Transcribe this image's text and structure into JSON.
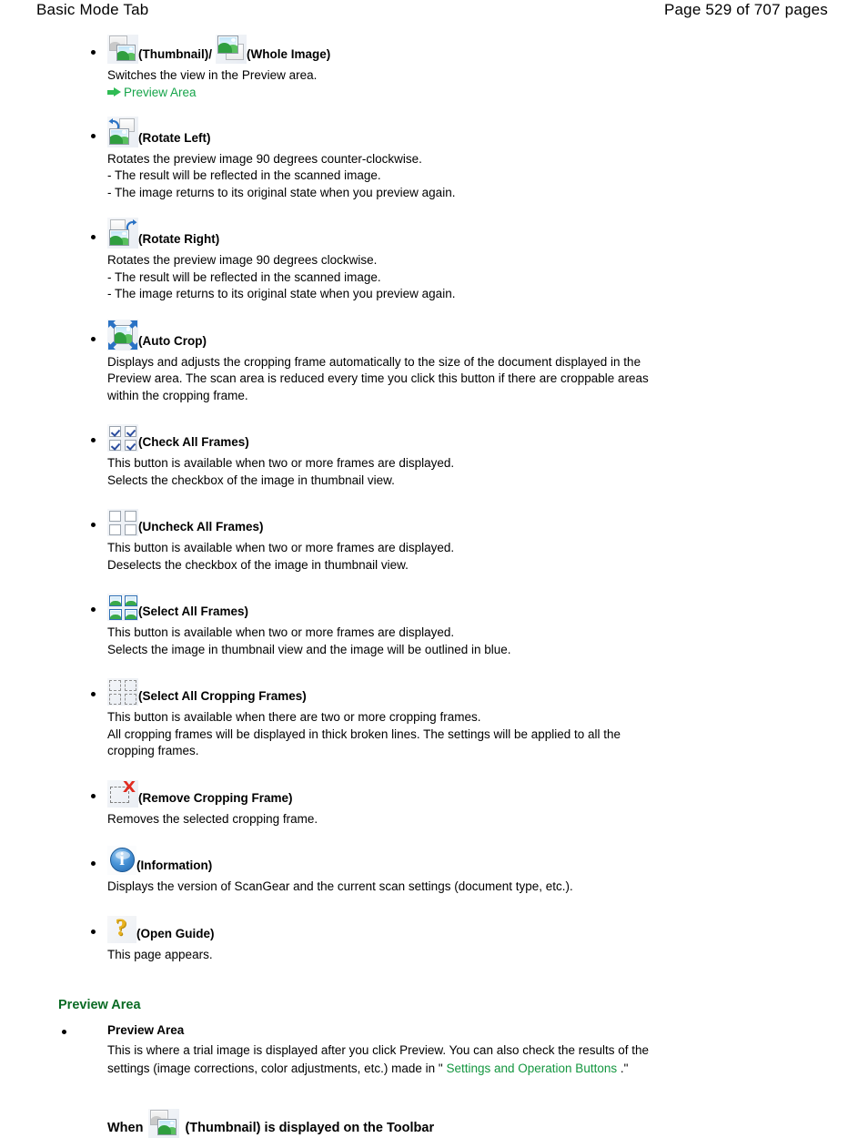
{
  "header": {
    "title": "Basic Mode Tab",
    "page_label": "Page 529 of 707 pages"
  },
  "colors": {
    "link_green": "#16a44a",
    "heading_green": "#0a6b24",
    "text_black": "#000000",
    "page_background": "#ffffff"
  },
  "toolbar_items": [
    {
      "icon": "thumbnail-icon",
      "icon2": "whole-image-icon",
      "label": "(Thumbnail)",
      "separator": "/",
      "label2": "(Whole Image)",
      "description": "Switches the view in the Preview area.",
      "link": "Preview Area"
    },
    {
      "icon": "rotate-left-icon",
      "label": "(Rotate Left)",
      "description": "Rotates the preview image 90 degrees counter-clockwise.\n- The result will be reflected in the scanned image.\n- The image returns to its original state when you preview again."
    },
    {
      "icon": "rotate-right-icon",
      "label": "(Rotate Right)",
      "description": "Rotates the preview image 90 degrees clockwise.\n- The result will be reflected in the scanned image.\n- The image returns to its original state when you preview again."
    },
    {
      "icon": "auto-crop-icon",
      "label": "(Auto Crop)",
      "description": "Displays and adjusts the cropping frame automatically to the size of the document displayed in the Preview area. The scan area is reduced every time you click this button if there are croppable areas within the cropping frame."
    },
    {
      "icon": "check-all-frames-icon",
      "label": "(Check All Frames)",
      "description": "This button is available when two or more frames are displayed.\nSelects the checkbox of the image in thumbnail view."
    },
    {
      "icon": "uncheck-all-frames-icon",
      "label": "(Uncheck All Frames)",
      "description": "This button is available when two or more frames are displayed.\nDeselects the checkbox of the image in thumbnail view."
    },
    {
      "icon": "select-all-frames-icon",
      "label": "(Select All Frames)",
      "description": "This button is available when two or more frames are displayed.\nSelects the image in thumbnail view and the image will be outlined in blue."
    },
    {
      "icon": "select-all-cropping-frames-icon",
      "label": "(Select All Cropping Frames)",
      "description": "This button is available when there are two or more cropping frames.\nAll cropping frames will be displayed in thick broken lines. The settings will be applied to all the cropping frames."
    },
    {
      "icon": "remove-cropping-frame-icon",
      "label": "(Remove Cropping Frame)",
      "description": "Removes the selected cropping frame."
    },
    {
      "icon": "information-icon",
      "label": "(Information)",
      "description": "Displays the version of ScanGear and the current scan settings (document type, etc.)."
    },
    {
      "icon": "open-guide-icon",
      "label": "(Open Guide)",
      "description": "This page appears."
    }
  ],
  "preview_section": {
    "heading": "Preview Area",
    "item_title": "Preview Area",
    "body_part1": "This is where a trial image is displayed after you click Preview. You can also check the results of the settings (image corrections, color adjustments, etc.) made in \"",
    "body_link": "Settings and Operation Buttons",
    "body_part2": ".\"",
    "when_prefix": "When",
    "when_icon": "thumbnail-icon",
    "when_suffix": "(Thumbnail) is displayed on the Toolbar"
  }
}
